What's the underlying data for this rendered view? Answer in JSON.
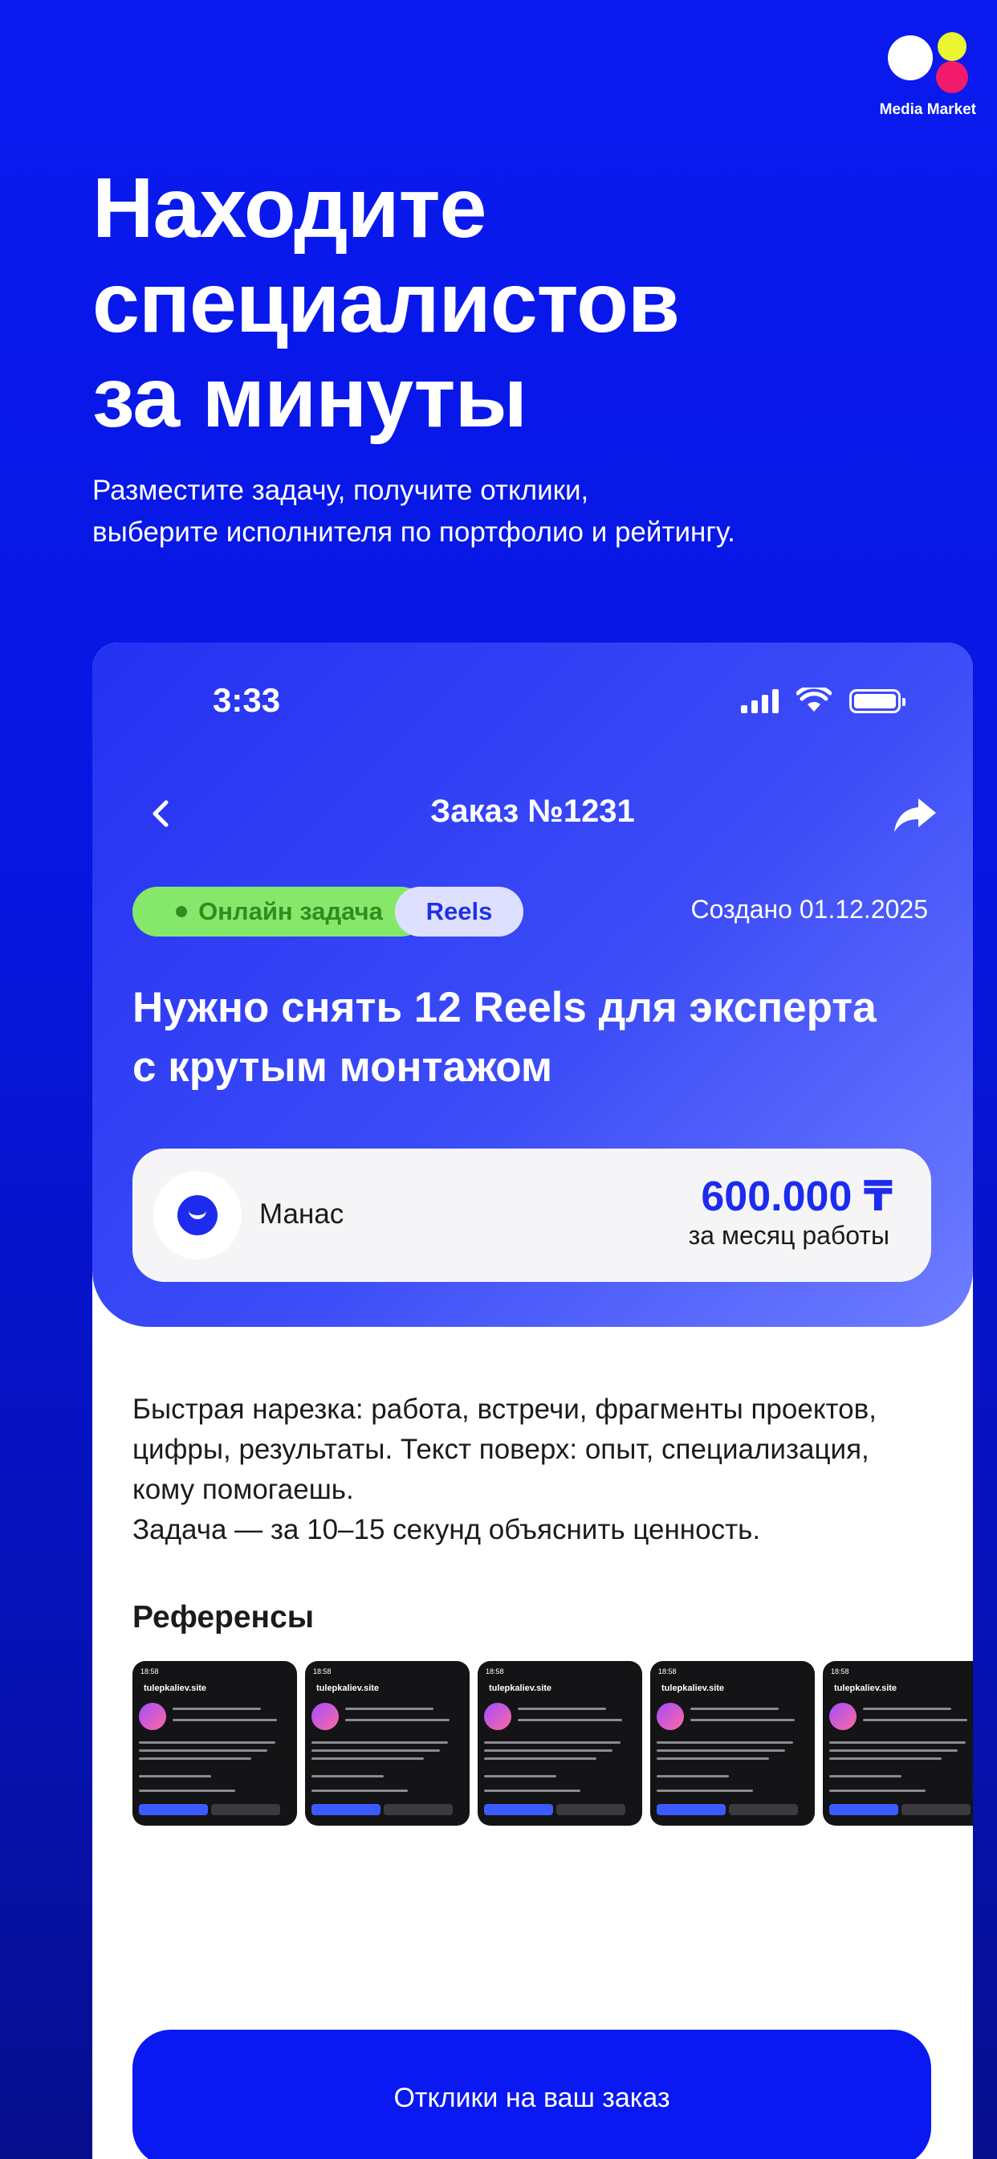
{
  "brand": {
    "name": "Media Market",
    "colors": [
      "#ffffff",
      "#e9f531",
      "#f21a6b"
    ]
  },
  "hero": {
    "title_lines": [
      "Находите",
      "специалистов",
      "за минуты"
    ],
    "subtitle_lines": [
      "Разместите задачу, получите отклики,",
      "выберите исполнителя по портфолио и рейтингу."
    ]
  },
  "status_bar": {
    "time": "3:33",
    "icons": [
      "cellular-signal-icon",
      "wifi-icon",
      "battery-icon"
    ]
  },
  "nav": {
    "title": "Заказ №1231",
    "back_icon": "chevron-left-icon",
    "share_icon": "share-arrow-icon"
  },
  "order": {
    "tags": [
      "Онлайн задача",
      "Reels"
    ],
    "created": "Создано 01.12.2025",
    "title_lines": [
      "Нужно снять 12 Reels для эксперта",
      "с крутым монтажом"
    ],
    "customer": {
      "name": "Манас",
      "price": "600.000 ₸",
      "price_note": "за месяц работы"
    },
    "description_lines": [
      "Быстрая нарезка: работа, встречи, фрагменты проектов,",
      "цифры, результаты. Текст поверх: опыт, специализация,",
      "кому помогаешь.",
      "Задача — за 10–15 секунд объяснить ценность."
    ],
    "references_title": "Референсы",
    "references": [
      {
        "time": "18:58",
        "username": "tulepkaliev.site"
      },
      {
        "time": "18:58",
        "username": "tulepkaliev.site"
      },
      {
        "time": "18:58",
        "username": "tulepkaliev.site"
      },
      {
        "time": "18:58",
        "username": "tulepkaliev.site"
      },
      {
        "time": "18:58",
        "username": "tulepkaliev.site"
      }
    ]
  },
  "cta": {
    "label": "Отклики на ваш заказ"
  },
  "colors": {
    "accent": "#0a18f2",
    "online_chip": "#86e86b",
    "price": "#1d2bef"
  }
}
